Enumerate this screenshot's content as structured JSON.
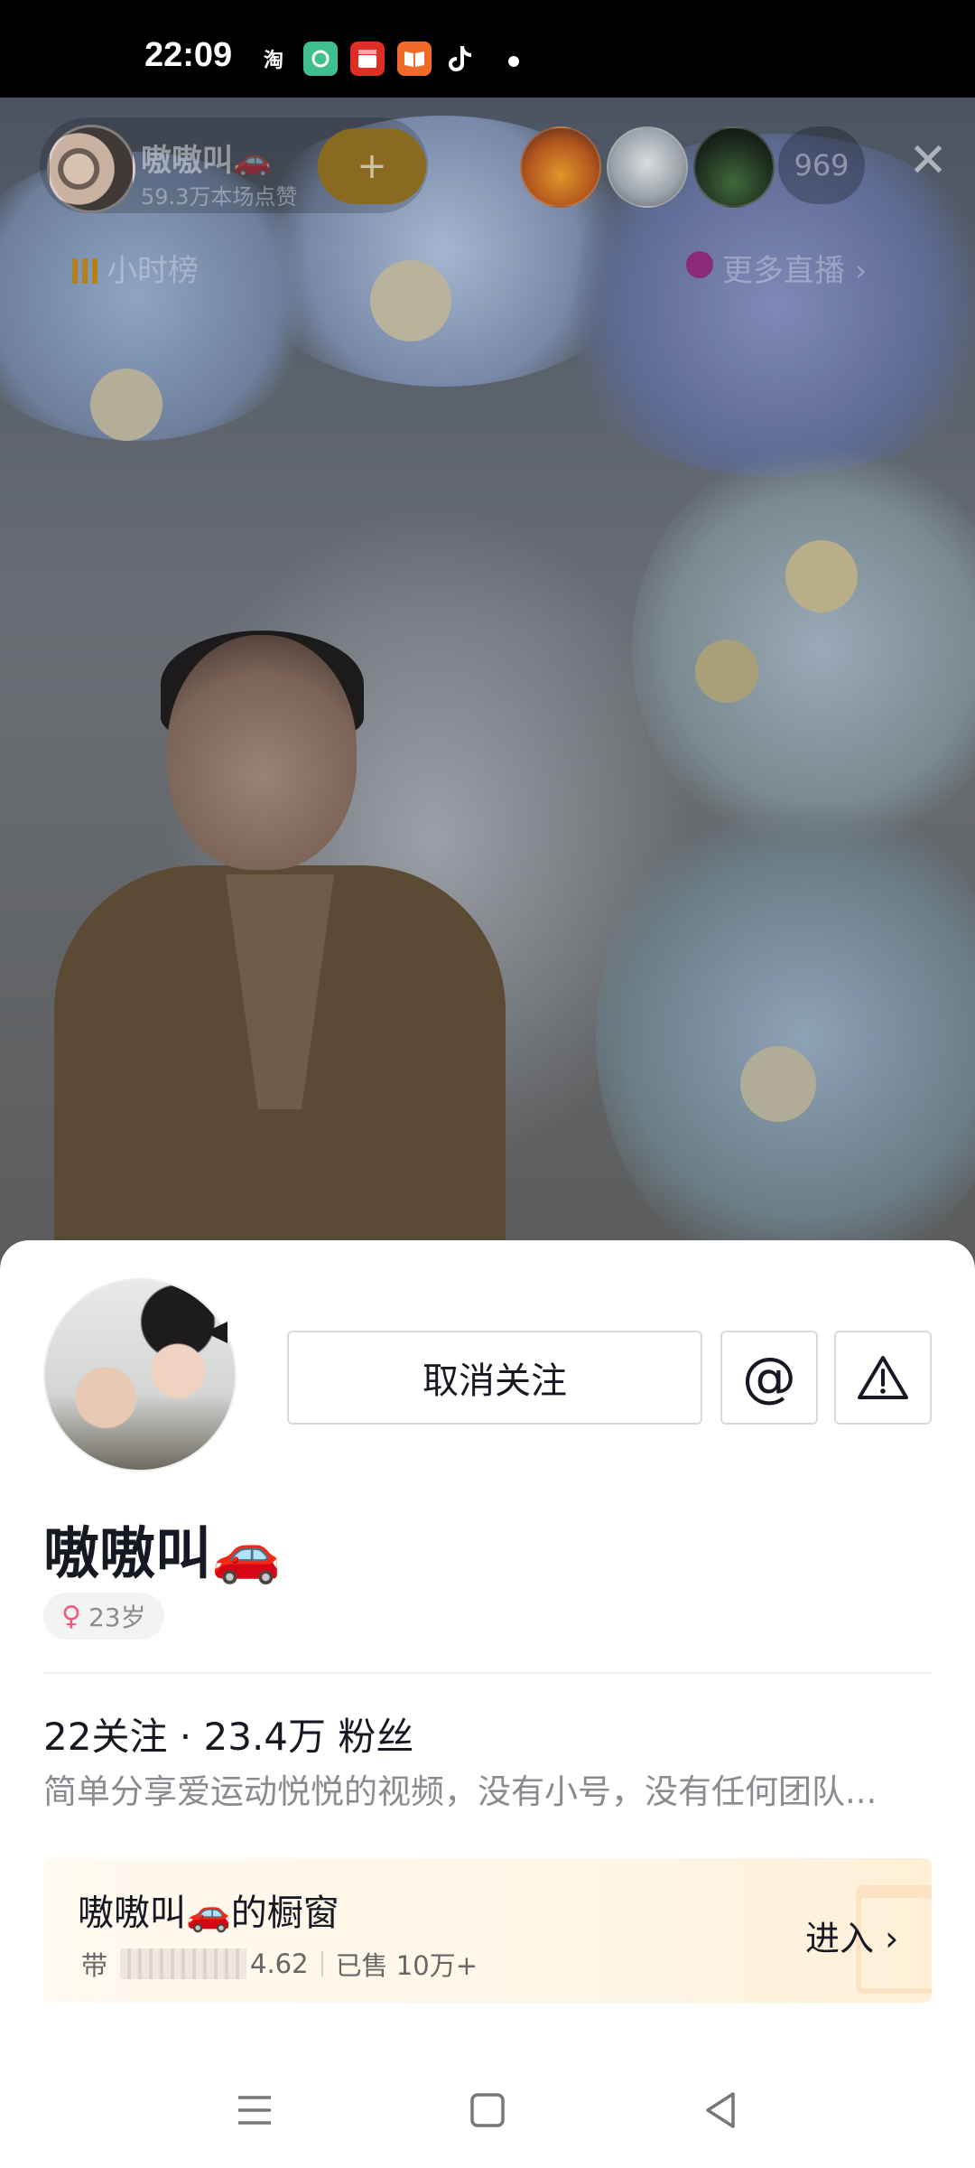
{
  "status_bar": {
    "time": "22:09",
    "icons": [
      "taobao-icon",
      "green-app-icon",
      "pinduoduo-icon",
      "reader-icon",
      "douyin-icon"
    ],
    "taobao_label": "淘"
  },
  "live_header": {
    "streamer_name": "嗷嗷叫🚗",
    "likes_text": "59.3万本场点赞",
    "follow_symbol": "+",
    "viewer_count": "969",
    "close_symbol": "✕",
    "rank_label": "小时榜",
    "more_live_label": "更多直播 ›"
  },
  "profile": {
    "unfollow_label": "取消关注",
    "mention_symbol": "@",
    "name": "嗷嗷叫🚗",
    "tag_symbol": "♀",
    "tag_text": "23岁",
    "stats": "22关注 · 23.4万 粉丝",
    "bio": "简单分享爱运动悦悦的视频，没有小号，没有任何团队..."
  },
  "shop": {
    "title": "嗷嗷叫🚗的橱窗",
    "prefix": "带",
    "rating": "4.62",
    "sold": "已售 10万+",
    "enter_label": "进入 ›"
  },
  "colors": {
    "accent_follow": "#8a6a1e",
    "text_primary": "#161823",
    "text_secondary": "#8a8b91",
    "female_pink": "#f2597f"
  }
}
